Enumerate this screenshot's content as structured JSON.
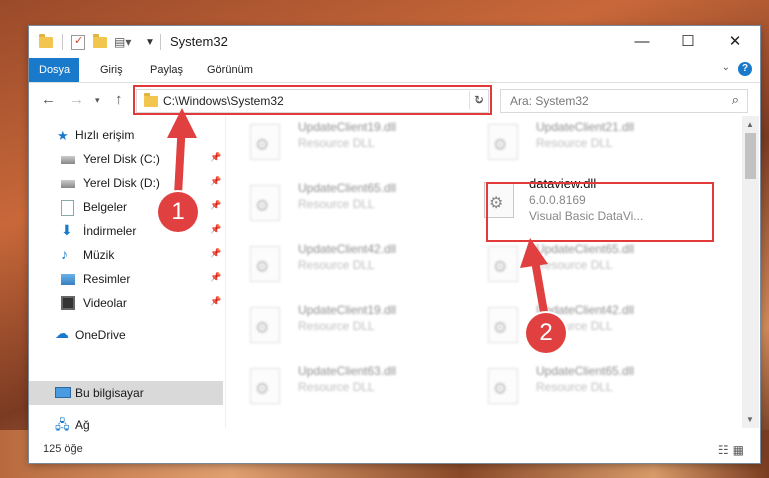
{
  "window": {
    "title": "System32",
    "controls": {
      "minimize": "—",
      "maximize": "☐",
      "close": "✕"
    }
  },
  "ribbon": {
    "tabs": [
      "Dosya",
      "Giriş",
      "Paylaş",
      "Görünüm"
    ],
    "help": "?"
  },
  "address": {
    "path": "C:\\Windows\\System32"
  },
  "search": {
    "placeholder": "Ara: System32"
  },
  "nav": {
    "items": [
      {
        "label": "Hızlı erişim",
        "icon": "star-icon"
      },
      {
        "label": "Yerel Disk (C:)",
        "icon": "drive-icon",
        "pinned": true
      },
      {
        "label": "Yerel Disk (D:)",
        "icon": "drive-icon",
        "pinned": true
      },
      {
        "label": "Belgeler",
        "icon": "document-icon",
        "pinned": true
      },
      {
        "label": "İndirmeler",
        "icon": "download-icon",
        "pinned": true
      },
      {
        "label": "Müzik",
        "icon": "music-icon",
        "pinned": true
      },
      {
        "label": "Resimler",
        "icon": "pictures-icon",
        "pinned": true
      },
      {
        "label": "Videolar",
        "icon": "video-icon",
        "pinned": true
      },
      {
        "label": "OneDrive",
        "icon": "cloud-icon"
      },
      {
        "label": "Bu bilgisayar",
        "icon": "computer-icon",
        "selected": true
      },
      {
        "label": "Ağ",
        "icon": "network-icon"
      }
    ]
  },
  "files": [
    {
      "name": "UpdateClient19.dll",
      "type": "Resource DLL"
    },
    {
      "name": "UpdateClient21.dll",
      "type": "Resource DLL"
    },
    {
      "name": "UpdateClient65.dll",
      "type": "Resource DLL"
    },
    {
      "name": "dataview.dll",
      "version": "6.0.0.8169",
      "description": "Visual Basic DataVi...",
      "highlighted": true
    },
    {
      "name": "UpdateClient42.dll",
      "type": "Resource DLL"
    },
    {
      "name": "UpdateClient65.dll",
      "type": "Resource DLL"
    },
    {
      "name": "UpdateClient19.dll",
      "type": "Resource DLL"
    },
    {
      "name": "UpdateClient42.dll",
      "type": "Resource DLL"
    },
    {
      "name": "UpdateClient63.dll",
      "type": "Resource DLL"
    },
    {
      "name": "UpdateClient65.dll",
      "type": "Resource DLL"
    }
  ],
  "status": {
    "count": "125 öğe"
  },
  "annotations": {
    "badge1": "1",
    "badge2": "2",
    "color": "#e0403f"
  }
}
